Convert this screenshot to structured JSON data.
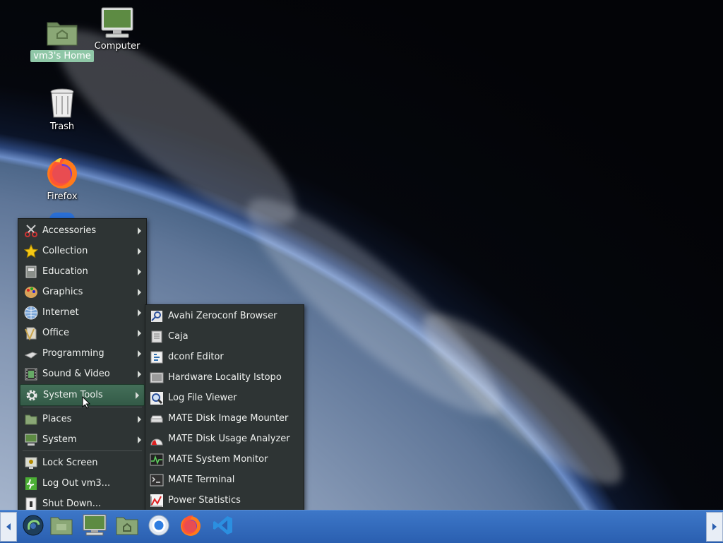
{
  "desktop": {
    "icons": {
      "home": {
        "label": "vm3's Home"
      },
      "computer": {
        "label": "Computer"
      },
      "trash": {
        "label": "Trash"
      },
      "firefox": {
        "label": "Firefox"
      }
    }
  },
  "main_menu": {
    "items": [
      {
        "label": "Accessories",
        "icon": "scissors-icon"
      },
      {
        "label": "Collection",
        "icon": "star-icon"
      },
      {
        "label": "Education",
        "icon": "book-icon"
      },
      {
        "label": "Graphics",
        "icon": "palette-icon"
      },
      {
        "label": "Internet",
        "icon": "globe-icon"
      },
      {
        "label": "Office",
        "icon": "office-icon"
      },
      {
        "label": "Programming",
        "icon": "code-icon"
      },
      {
        "label": "Sound & Video",
        "icon": "film-icon"
      },
      {
        "label": "System Tools",
        "icon": "gear-icon",
        "active": true
      },
      {
        "label": "Places",
        "icon": "folder-icon"
      },
      {
        "label": "System",
        "icon": "monitor-icon"
      }
    ],
    "actions": [
      {
        "label": "Lock Screen",
        "icon": "lock-screen-icon"
      },
      {
        "label": "Log Out vm3...",
        "icon": "logout-icon"
      },
      {
        "label": "Shut Down...",
        "icon": "shutdown-icon"
      }
    ]
  },
  "system_tools": {
    "items": [
      {
        "label": "Avahi Zeroconf Browser",
        "icon": "network-search-icon"
      },
      {
        "label": "Caja",
        "icon": "file-manager-icon"
      },
      {
        "label": "dconf Editor",
        "icon": "dconf-icon"
      },
      {
        "label": "Hardware Locality lstopo",
        "icon": "hardware-icon"
      },
      {
        "label": "Log File Viewer",
        "icon": "magnifier-icon"
      },
      {
        "label": "MATE Disk Image Mounter",
        "icon": "disk-image-icon"
      },
      {
        "label": "MATE Disk Usage Analyzer",
        "icon": "disk-usage-icon"
      },
      {
        "label": "MATE System Monitor",
        "icon": "system-monitor-icon"
      },
      {
        "label": "MATE Terminal",
        "icon": "terminal-icon"
      },
      {
        "label": "Power Statistics",
        "icon": "power-stats-icon"
      }
    ]
  },
  "taskbar": {
    "launchers": [
      "menu-icon",
      "files-icon",
      "computer-icon",
      "home-folder-icon",
      "chromium-icon",
      "firefox-icon",
      "vscode-icon"
    ]
  }
}
